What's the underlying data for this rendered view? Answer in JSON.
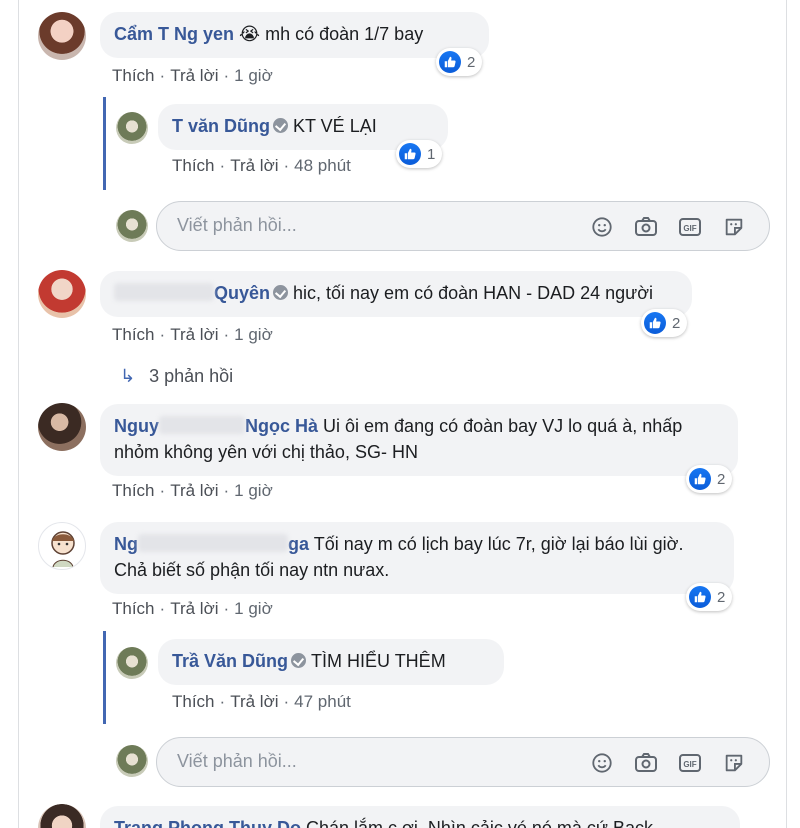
{
  "comments": [
    {
      "name_visible": "Cẩm T  Ng  yen",
      "text": " mh có đoàn 1/7 bay",
      "emoji": "😭",
      "actions": {
        "like": "Thích",
        "reply": "Trả lời",
        "time": "1 giờ"
      },
      "reactions": "2",
      "replies": [
        {
          "name_visible": "T   văn Dũng",
          "verified": true,
          "text": "KT VÉ LẠI",
          "actions": {
            "like": "Thích",
            "reply": "Trả lời",
            "time": "48 phút"
          },
          "reactions": "1"
        }
      ]
    },
    {
      "name_visible": "Quyên",
      "verified": true,
      "text": "hic, tối nay em có đoàn HAN - DAD 24 người",
      "actions": {
        "like": "Thích",
        "reply": "Trả lời",
        "time": "1 giờ"
      },
      "reactions": "2",
      "see_replies": "3 phản hồi"
    },
    {
      "name_visible_a": "Nguy",
      "name_visible_b": "Ngọc Hà",
      "text_line1": "Ui ôi em đang có đoàn bay VJ lo quá à, nhấp",
      "text_line2": "nhỏm không yên với chị thảo, SG- HN",
      "actions": {
        "like": "Thích",
        "reply": "Trả lời",
        "time": "1 giờ"
      },
      "reactions": "2"
    },
    {
      "name_visible_a": "Ng",
      "name_visible_b": "ga",
      "text_line1": "Tối nay m có lịch bay lúc 7r, giờ lại báo lùi giờ.",
      "text_line2": "Chả biết số phận tối nay ntn nưax.",
      "actions": {
        "like": "Thích",
        "reply": "Trả lời",
        "time": "1 giờ"
      },
      "reactions": "2",
      "replies": [
        {
          "name_visible": "Trầ  Văn Dũng",
          "verified": true,
          "text": "TÌM HIỂU THÊM",
          "actions": {
            "like": "Thích",
            "reply": "Trả lời",
            "time": "47 phút"
          }
        }
      ]
    },
    {
      "name_visible": "Trang Phong Thuy Do",
      "text": "Chán lắm c ơi. Nhìn cảic vé nó mà cứ Back"
    }
  ],
  "reply_box": {
    "placeholder": "Viết phản hồi...",
    "icons": [
      "smiley-icon",
      "camera-icon",
      "gif-icon",
      "sticker-icon"
    ]
  },
  "colors": {
    "name": "#385898",
    "bubble": "#f2f3f5",
    "like_blue": "#1877f2",
    "thread_line": "#4267b2"
  }
}
